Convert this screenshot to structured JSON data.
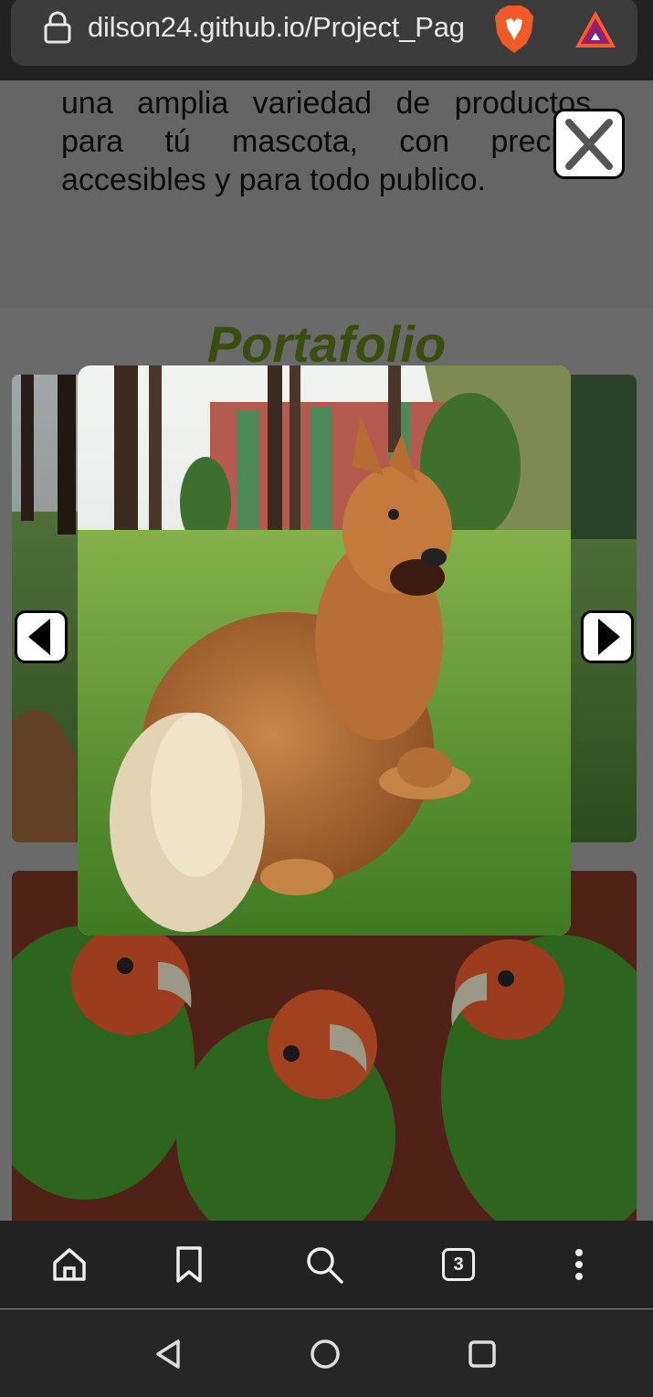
{
  "browser": {
    "url": "dilson24.github.io/Project_Pag",
    "icons": [
      "lock-icon",
      "brave-lion-icon",
      "bat-rewards-icon"
    ]
  },
  "page": {
    "intro_text": "una amplia variedad de productos para tú mascota, con precios accesibles y para todo publico.",
    "portfolio_title": "Portafolio"
  },
  "modal": {
    "image_subject": "dog-in-park",
    "buttons": [
      "close-icon",
      "arrow-left-icon",
      "arrow-right-icon"
    ]
  },
  "toolbar": {
    "tab_count": "3",
    "icons": [
      "home-icon",
      "bookmark-icon",
      "search-icon",
      "tabs-icon",
      "more-icon"
    ]
  },
  "system_nav": {
    "icons": [
      "back-icon",
      "home-circle-icon",
      "recents-icon"
    ]
  },
  "colors": {
    "portfolio_title": "#4f6b12",
    "browser_bar": "#222222",
    "overlay": "rgba(0,0,0,0.28)"
  }
}
